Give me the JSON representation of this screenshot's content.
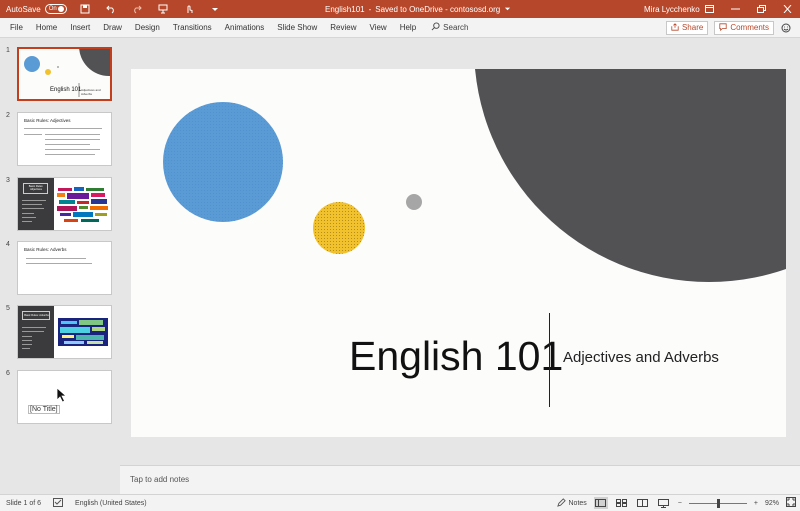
{
  "titlebar": {
    "autosave_label": "AutoSave",
    "autosave_state": "On",
    "filename": "English101",
    "separator": "-",
    "save_status": "Saved to OneDrive - contososd.org",
    "user_name": "Mira Lycchenko",
    "background_color": "#b7472a"
  },
  "ribbon": {
    "tabs": [
      "File",
      "Home",
      "Insert",
      "Draw",
      "Design",
      "Transitions",
      "Animations",
      "Slide Show",
      "Review",
      "View",
      "Help"
    ],
    "search_label": "Search",
    "share_label": "Share",
    "comments_label": "Comments"
  },
  "thumbnails": [
    {
      "number": "1",
      "title": "English 101",
      "subtitle": "Adjectives and Adverbs"
    },
    {
      "number": "2",
      "title": "Basic Rules: Adjectives"
    },
    {
      "number": "3",
      "title": "Basic Rules: Adjectives"
    },
    {
      "number": "4",
      "title": "Basic Rules: Adverbs"
    },
    {
      "number": "5",
      "title": "Basic Rules: Adverbs"
    },
    {
      "number": "6",
      "title": "[No Title]"
    }
  ],
  "slide": {
    "title": "English 101",
    "subtitle": "Adjectives and Adverbs",
    "colors": {
      "blue_circle": "#5b9bd5",
      "yellow_circle": "#f2c12e",
      "gray_circle": "#a6a6a6",
      "dark_circle": "#525254"
    }
  },
  "notes": {
    "placeholder": "Tap to add notes"
  },
  "statusbar": {
    "slide_info": "Slide 1 of 6",
    "language": "English (United States)",
    "notes_label": "Notes",
    "zoom_minus": "−",
    "zoom_plus": "+",
    "zoom_level": "92%"
  }
}
